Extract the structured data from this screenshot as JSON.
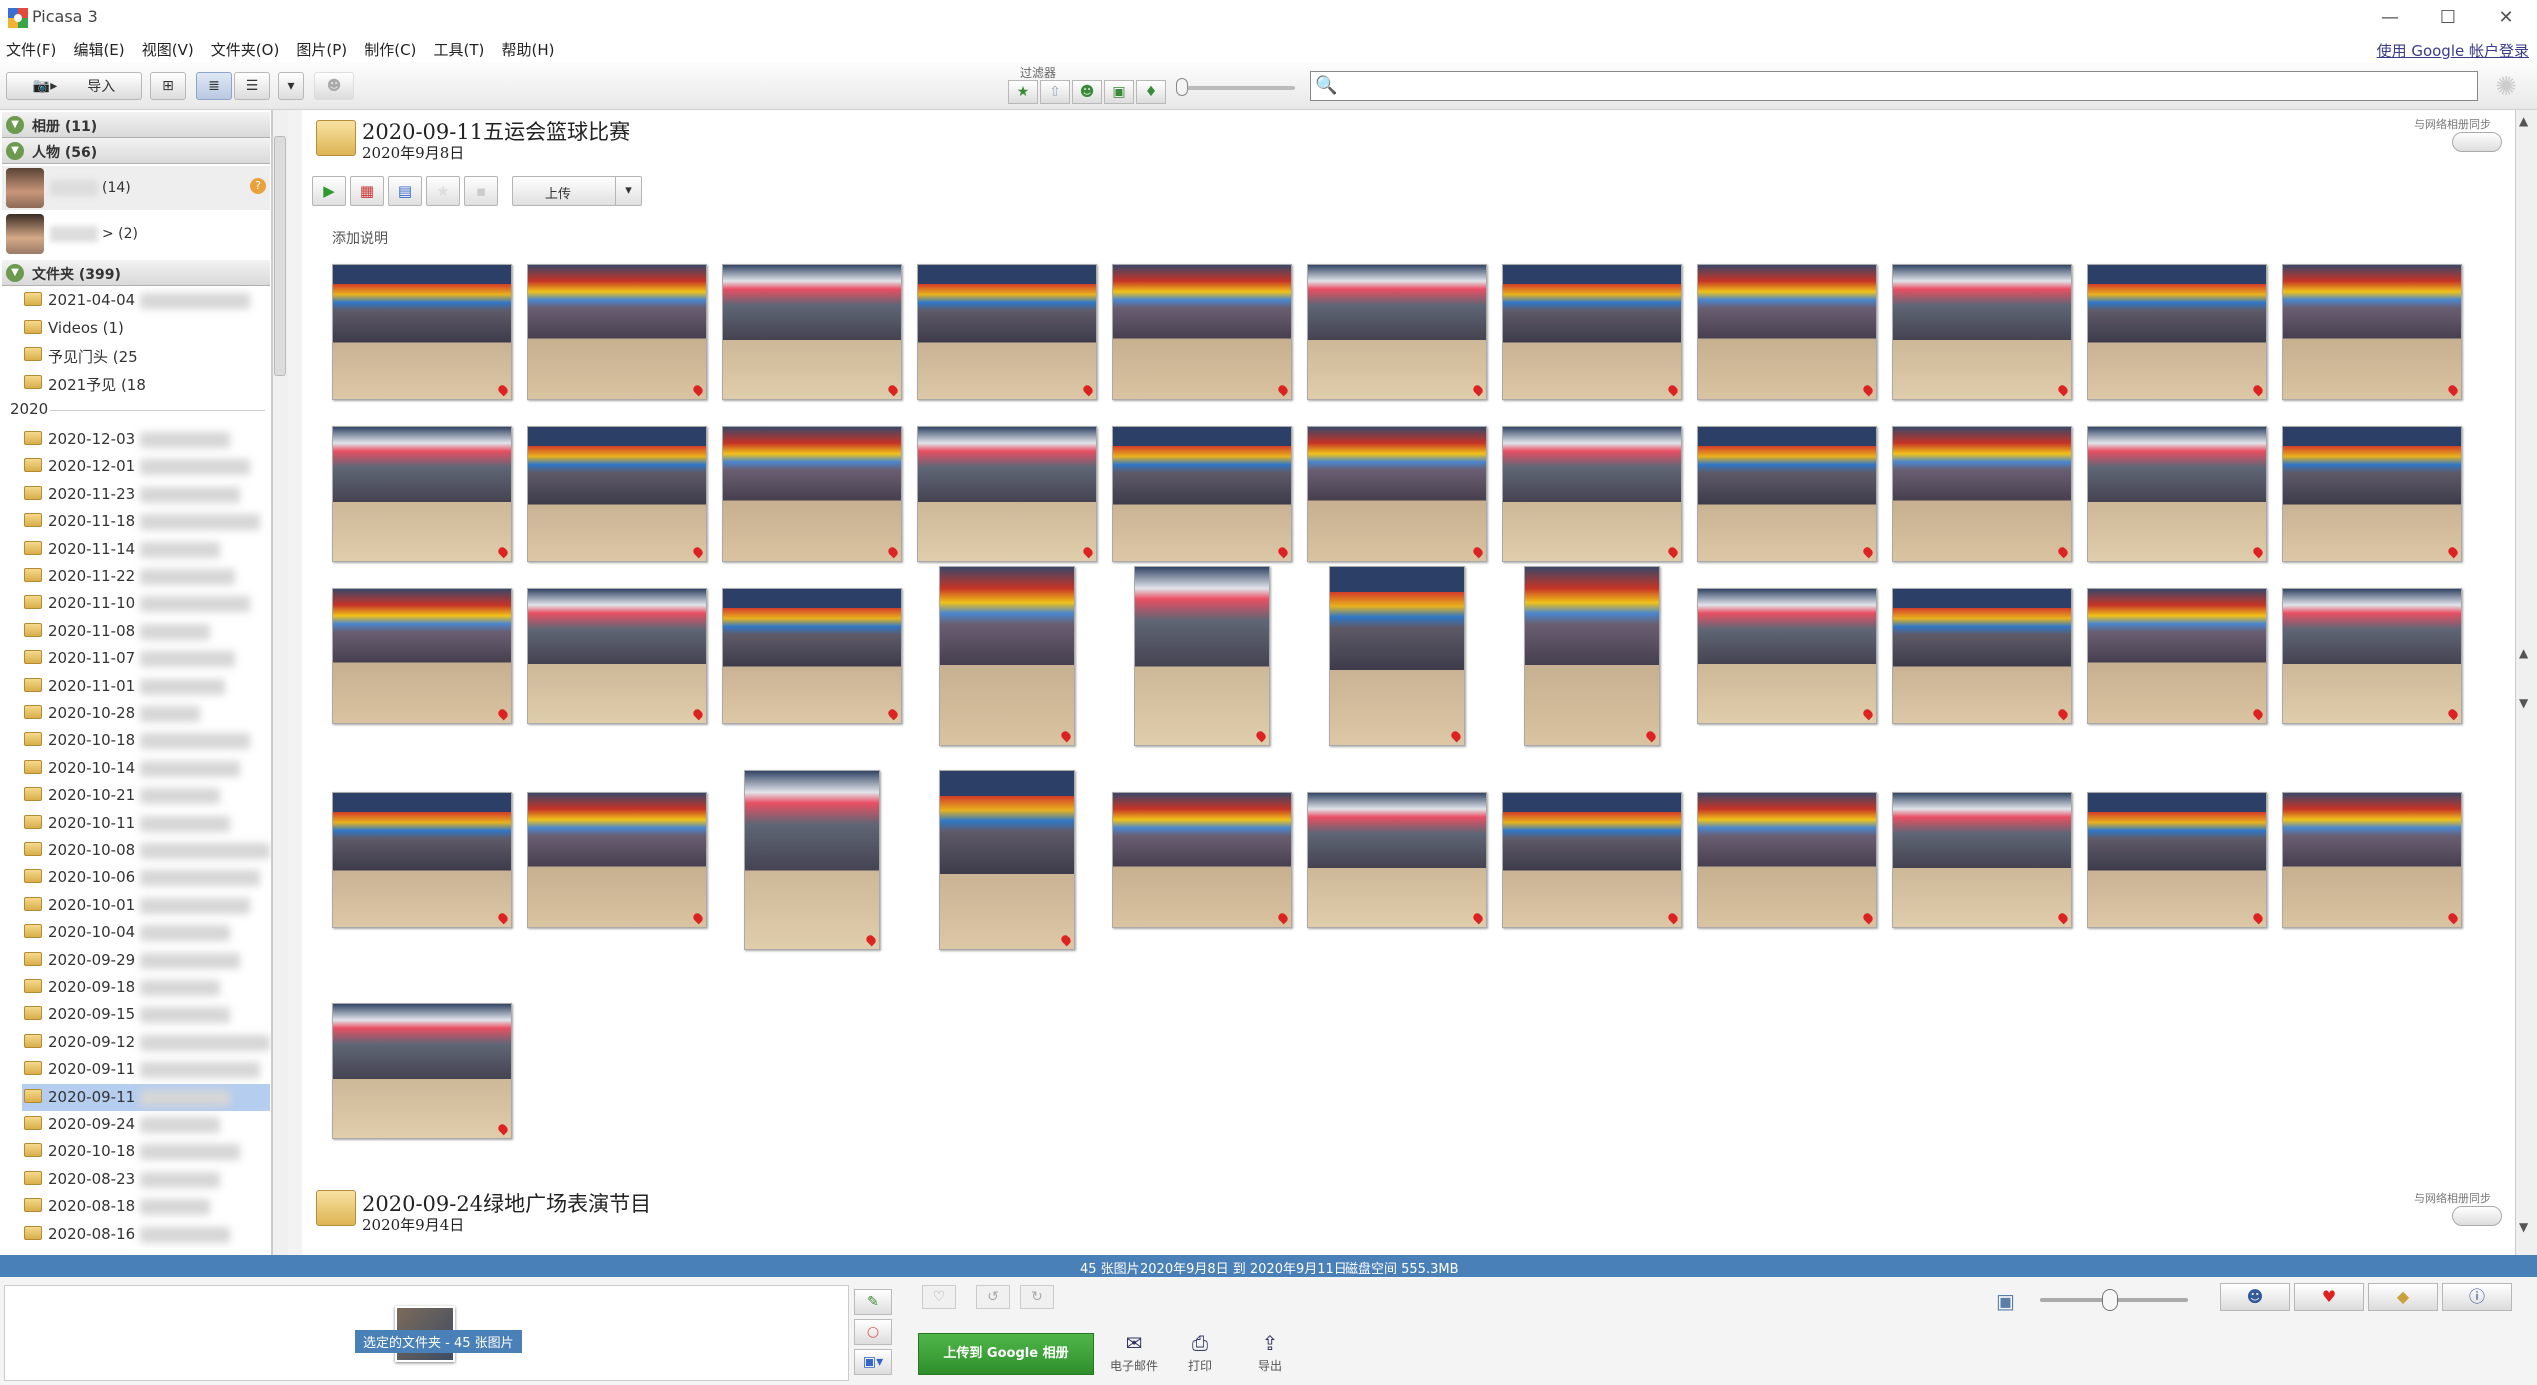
{
  "window": {
    "title": "Picasa 3",
    "sign_in": "使用 Google 帐户登录"
  },
  "menu": [
    "文件(F)",
    "编辑(E)",
    "视图(V)",
    "文件夹(O)",
    "图片(P)",
    "制作(C)",
    "工具(T)",
    "帮助(H)"
  ],
  "toolbar": {
    "import_label": "导入",
    "filter_label": "过滤器",
    "search_placeholder": ""
  },
  "sidebar": {
    "albums_section": "相册 (11)",
    "people_section": "人物 (56)",
    "people": [
      {
        "count": "(14)"
      },
      {
        "count": "> (2)"
      }
    ],
    "folders_section": "文件夹 (399)",
    "top_folders": [
      "2021-04-04",
      "Videos (1)",
      "予见门头 (25",
      "2021予见 (18"
    ],
    "year": "2020",
    "folders": [
      "2020-12-03",
      "2020-12-01",
      "2020-11-23",
      "2020-11-18",
      "2020-11-14",
      "2020-11-22",
      "2020-11-10",
      "2020-11-08",
      "2020-11-07",
      "2020-11-01",
      "2020-10-28",
      "2020-10-18",
      "2020-10-14",
      "2020-10-21",
      "2020-10-11",
      "2020-10-08",
      "2020-10-06",
      "2020-10-01",
      "2020-10-04",
      "2020-09-29",
      "2020-09-18",
      "2020-09-15",
      "2020-09-12",
      "2020-09-11",
      "2020-09-11",
      "2020-09-24",
      "2020-10-18",
      "2020-08-23",
      "2020-08-18",
      "2020-08-16"
    ],
    "selected_folder_index": 24
  },
  "album1": {
    "title": "2020-09-11五运会篮球比赛",
    "date": "2020年9月8日",
    "sync_label": "与网络相册同步",
    "upload_label": "上传",
    "caption_placeholder": "添加说明"
  },
  "album2": {
    "title": "2020-09-24绿地广场表演节目",
    "date": "2020年9月4日",
    "sync_label": "与网络相册同步"
  },
  "status": {
    "count": "45 张图片",
    "range": "2020年9月8日 到 2020年9月11日",
    "disk": "磁盘空间 555.3MB"
  },
  "tray": {
    "label": "选定的文件夹 - 45 张图片"
  },
  "bottom_actions": {
    "upload_google": "上传到 Google 相册",
    "email": "电子邮件",
    "print": "打印",
    "export": "导出"
  },
  "colors": {
    "accent": "#4a80b8",
    "upload_green": "#3ca236",
    "selection": "#b5cdee"
  },
  "icons": {
    "play": "play-icon",
    "star": "star-icon",
    "search": "search-icon",
    "email": "envelope-icon",
    "print": "printer-icon",
    "export": "export-icon",
    "person": "person-icon",
    "pin": "map-pin-icon",
    "info": "info-icon"
  }
}
